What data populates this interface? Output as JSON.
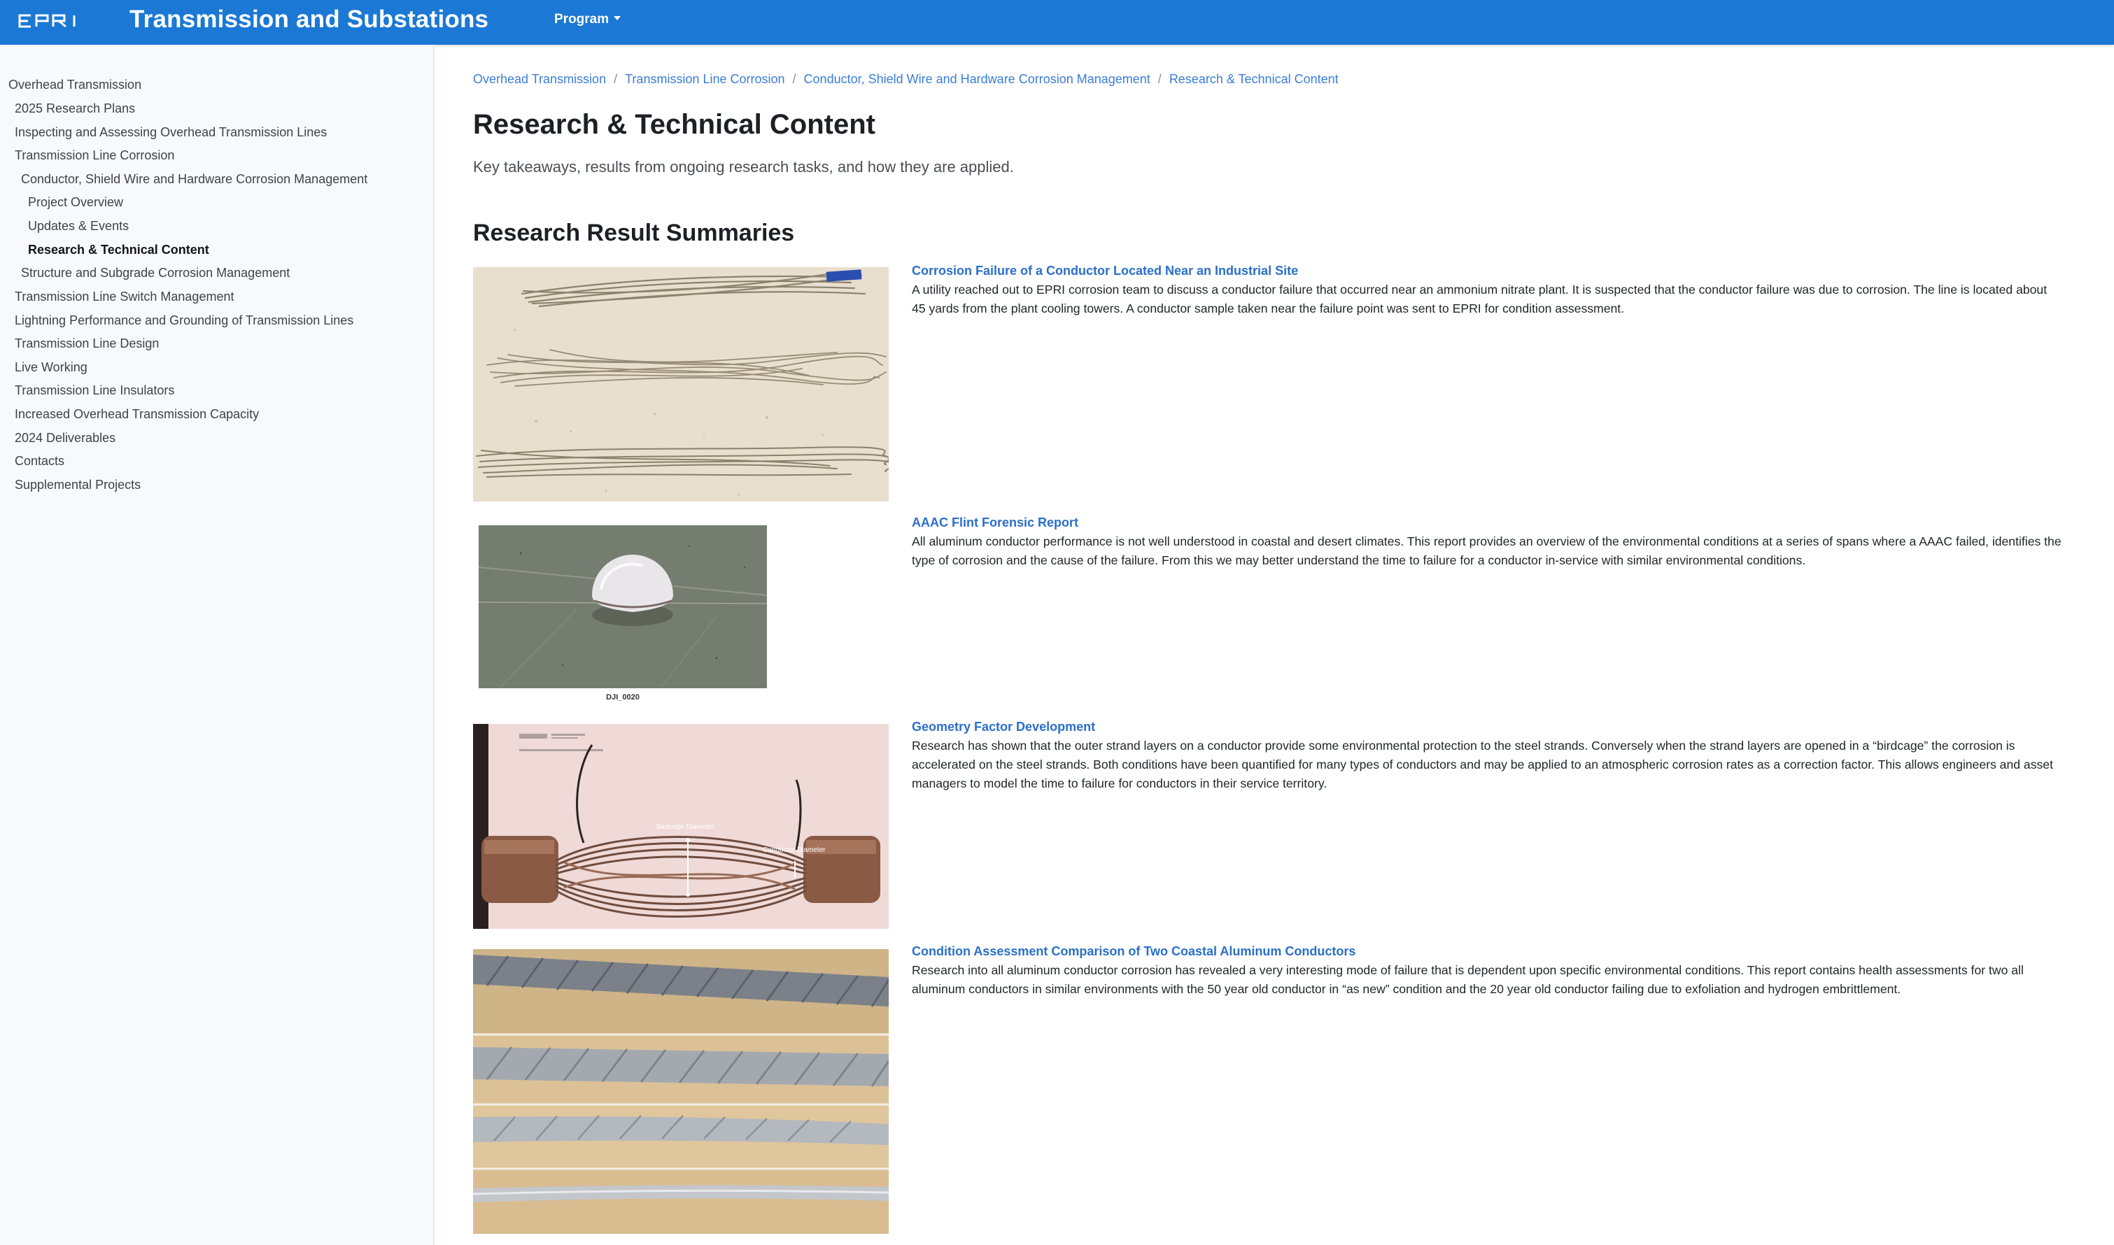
{
  "header": {
    "logo_text": "EPRI",
    "title": "Transmission and Substations",
    "program_label": "Program"
  },
  "sidebar": {
    "items": [
      {
        "label": "Overhead Transmission",
        "level": 0,
        "active": false
      },
      {
        "label": "2025 Research Plans",
        "level": 1,
        "active": false
      },
      {
        "label": "Inspecting and Assessing Overhead Transmission Lines",
        "level": 1,
        "active": false
      },
      {
        "label": "Transmission Line Corrosion",
        "level": 1,
        "active": false
      },
      {
        "label": "Conductor, Shield Wire and Hardware Corrosion Management",
        "level": 2,
        "active": false
      },
      {
        "label": "Project Overview",
        "level": 3,
        "active": false
      },
      {
        "label": "Updates & Events",
        "level": 3,
        "active": false
      },
      {
        "label": "Research & Technical Content",
        "level": 3,
        "active": true
      },
      {
        "label": "Structure and Subgrade Corrosion Management",
        "level": 2,
        "active": false
      },
      {
        "label": "Transmission Line Switch Management",
        "level": 1,
        "active": false
      },
      {
        "label": "Lightning Performance and Grounding of Transmission Lines",
        "level": 1,
        "active": false
      },
      {
        "label": "Transmission Line Design",
        "level": 1,
        "active": false
      },
      {
        "label": "Live Working",
        "level": 1,
        "active": false
      },
      {
        "label": "Transmission Line Insulators",
        "level": 1,
        "active": false
      },
      {
        "label": "Increased Overhead Transmission Capacity",
        "level": 1,
        "active": false
      },
      {
        "label": "2024 Deliverables",
        "level": 1,
        "active": false
      },
      {
        "label": "Contacts",
        "level": 1,
        "active": false
      },
      {
        "label": "Supplemental Projects",
        "level": 1,
        "active": false
      }
    ]
  },
  "breadcrumb": [
    "Overhead Transmission",
    "Transmission Line Corrosion",
    "Conductor, Shield Wire and Hardware Corrosion Management",
    "Research & Technical Content"
  ],
  "page": {
    "title": "Research & Technical Content",
    "subtitle": "Key takeaways, results from ongoing research tasks, and how they are applied.",
    "section_title": "Research Result Summaries"
  },
  "cards": [
    {
      "title": "Corrosion Failure of a Conductor Located Near an Industrial Site",
      "text": "A utility reached out to EPRI corrosion team to discuss a conductor failure that occurred near an ammonium nitrate plant. It is suspected that the conductor failure was due to corrosion. The line is located about 45 yards from the plant cooling towers. A conductor sample taken near the failure point was sent to EPRI for condition assessment."
    },
    {
      "title": "AAAC Flint Forensic Report",
      "text": "All aluminum conductor performance is not well understood in coastal and desert climates. This report provides an overview of the environmental conditions at a series of spans where a AAAC failed, identifies the type of corrosion and the cause of the failure. From this we may better understand the time to failure for a conductor in-service with similar environmental conditions.",
      "caption": "DJI_0020"
    },
    {
      "title": "Geometry Factor Development",
      "text": "Research has shown that the outer strand layers on a conductor provide some environmental protection to the steel strands. Conversely when the strand layers are opened in a “birdcage” the corrosion is accelerated on the steel strands. Both conditions have been quantified for many types of conductors and may be applied to an atmospheric corrosion rates as a correction factor. This allows engineers and asset managers to model the time to failure for conductors in their service territory.",
      "img_labels": [
        "Birdcage Diameter",
        "Conductor Diameter"
      ]
    },
    {
      "title": "Condition Assessment Comparison of Two Coastal Aluminum Conductors",
      "text": "Research into all aluminum conductor corrosion has revealed a very interesting mode of failure that is dependent upon specific environmental conditions. This report contains health assessments for two all aluminum conductors in similar environments with the 50 year old conductor in “as new” condition and the 20 year old conductor failing due to exfoliation and hydrogen embrittlement."
    }
  ]
}
